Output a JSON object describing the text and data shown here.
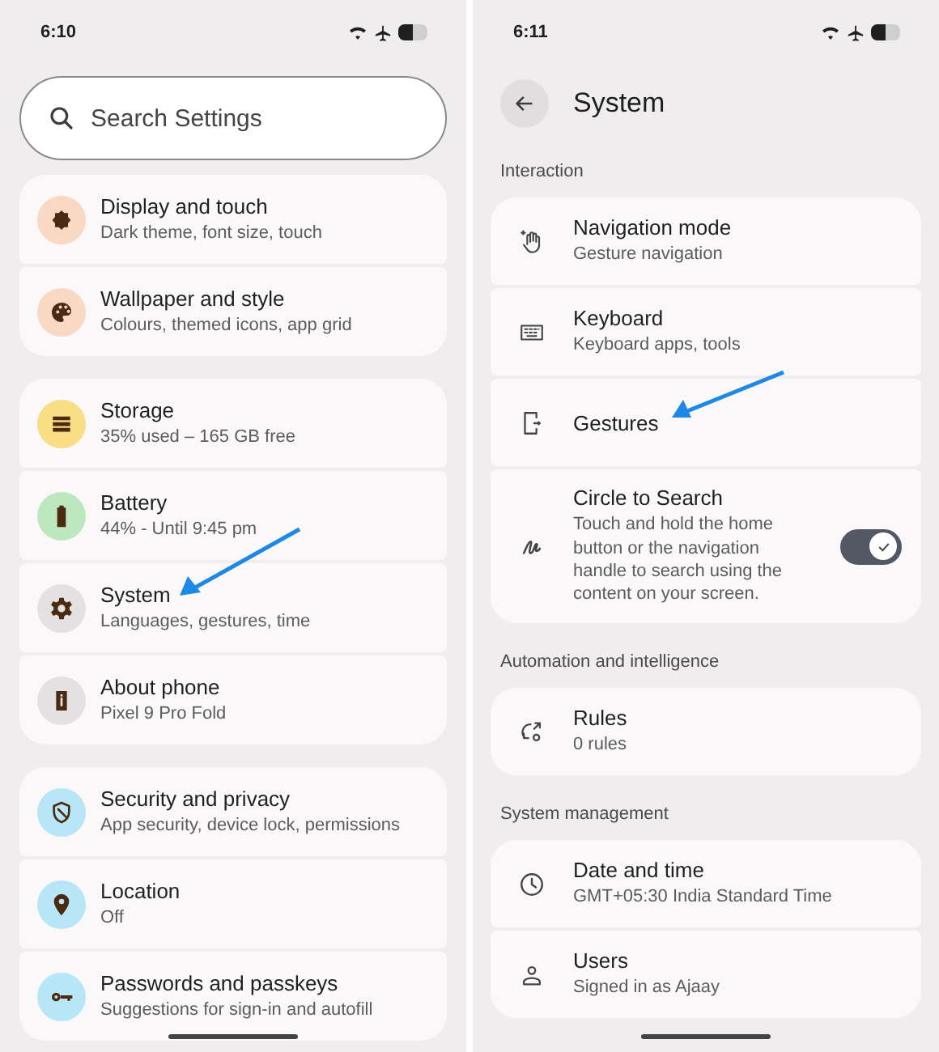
{
  "left_screen": {
    "status_bar": {
      "time": "6:10"
    },
    "search": {
      "placeholder": "Search Settings"
    },
    "groups": [
      {
        "items": [
          {
            "kind": "display",
            "color": "#f9d9c4",
            "title": "Display and touch",
            "subtitle": "Dark theme, font size, touch"
          },
          {
            "kind": "palette",
            "color": "#f9d9c4",
            "title": "Wallpaper and style",
            "subtitle": "Colours, themed icons, app grid"
          }
        ]
      },
      {
        "items": [
          {
            "kind": "storage",
            "color": "#f9dd84",
            "title": "Storage",
            "subtitle": "35% used – 165 GB free"
          },
          {
            "kind": "battery",
            "color": "#bde8bf",
            "title": "Battery",
            "subtitle": "44% - Until 9:45 pm"
          },
          {
            "kind": "gear",
            "color": "#e3e1e2",
            "title": "System",
            "subtitle": "Languages, gestures, time"
          },
          {
            "kind": "info",
            "color": "#e3e1e2",
            "title": "About phone",
            "subtitle": "Pixel 9 Pro Fold"
          }
        ]
      },
      {
        "items": [
          {
            "kind": "shield",
            "color": "#b6e6f7",
            "title": "Security and privacy",
            "subtitle": "App security, device lock, permissions"
          },
          {
            "kind": "pin",
            "color": "#b6e6f7",
            "title": "Location",
            "subtitle": "Off"
          },
          {
            "kind": "key",
            "color": "#b6e6f7",
            "title": "Passwords and passkeys",
            "subtitle": "Suggestions for sign-in and autofill"
          }
        ]
      }
    ]
  },
  "right_screen": {
    "status_bar": {
      "time": "6:11"
    },
    "title": "System",
    "sections": [
      {
        "label": "Interaction",
        "items": [
          {
            "kind": "hand",
            "title": "Navigation mode",
            "subtitle": "Gesture navigation"
          },
          {
            "kind": "keyboard",
            "title": "Keyboard",
            "subtitle": "Keyboard apps, tools"
          },
          {
            "kind": "phone",
            "title": "Gestures"
          },
          {
            "kind": "squiggle",
            "title": "Circle to Search",
            "subtitle": "Touch and hold the home button or the navigation handle to search using the content on your screen.",
            "toggle": {
              "checked": true
            }
          }
        ]
      },
      {
        "label": "Automation and intelligence",
        "items": [
          {
            "kind": "rules",
            "title": "Rules",
            "subtitle": "0 rules"
          }
        ]
      },
      {
        "label": "System management",
        "items": [
          {
            "kind": "clock",
            "title": "Date and time",
            "subtitle": "GMT+05:30 India Standard Time"
          },
          {
            "kind": "person",
            "title": "Users",
            "subtitle": "Signed in as Ajaay"
          }
        ]
      }
    ]
  }
}
